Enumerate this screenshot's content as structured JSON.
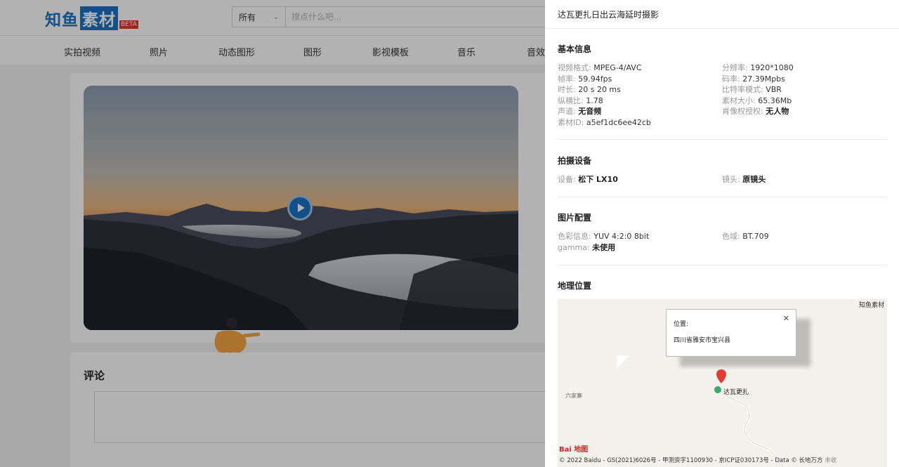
{
  "header": {
    "logo_text_a": "知鱼",
    "logo_text_b": "素材",
    "logo_badge": "BETA",
    "search_scope": "所有",
    "search_placeholder": "搜点什么吧..."
  },
  "nav": {
    "items": [
      "实拍视频",
      "照片",
      "动态图形",
      "图形",
      "影视模板",
      "音乐",
      "音效"
    ]
  },
  "comments": {
    "title": "评论"
  },
  "drawer": {
    "title": "达瓦更扎日出云海延时摄影",
    "basic": {
      "title": "基本信息",
      "video_format_label": "视频格式:",
      "video_format": "MPEG-4/AVC",
      "resolution_label": "分辨率:",
      "resolution": "1920*1080",
      "framerate_label": "帧率:",
      "framerate": "59.94fps",
      "bitrate_label": "码率:",
      "bitrate": "27.39Mpbs",
      "duration_label": "时长:",
      "duration": "20 s 20 ms",
      "bitrate_mode_label": "比特率模式:",
      "bitrate_mode": "VBR",
      "aspect_label": "纵横比:",
      "aspect": "1.78",
      "size_label": "素材大小:",
      "size": "65.36Mb",
      "audio_label": "声道:",
      "audio": "无音频",
      "portrait_label": "肖像权授权:",
      "portrait": "无人物",
      "id_label": "素材ID:",
      "id": "a5ef1dc6ee42cb"
    },
    "device": {
      "title": "拍摄设备",
      "camera_label": "设备:",
      "camera": "松下 LX10",
      "lens_label": "镜头:",
      "lens": "原镜头"
    },
    "image_config": {
      "title": "图片配置",
      "color_label": "色彩信息:",
      "color": "YUV 4:2:0 8bit",
      "gamut_label": "色域:",
      "gamut": "BT.709",
      "gamma_label": "gamma:",
      "gamma": "未使用"
    },
    "location": {
      "title": "地理位置",
      "map_brand": "知鱼素材",
      "popup_label": "位置:",
      "popup_text": "四川省雅安市宝兴县",
      "marker_label": "达瓦更扎",
      "nearby_label": "六家寨",
      "logo_text": "Bai 地图",
      "copyright": "© 2022 Baidu - GS(2021)6026号 - 甲测资字1100930 - 京ICP证030173号 - Data © 长地万方",
      "copyright_extra": "丰收"
    }
  },
  "colors": {
    "brand": "#1a73c4",
    "badge": "#e4352a",
    "overlay": "rgba(0,0,0,0.30)",
    "pin": "#e53935"
  }
}
